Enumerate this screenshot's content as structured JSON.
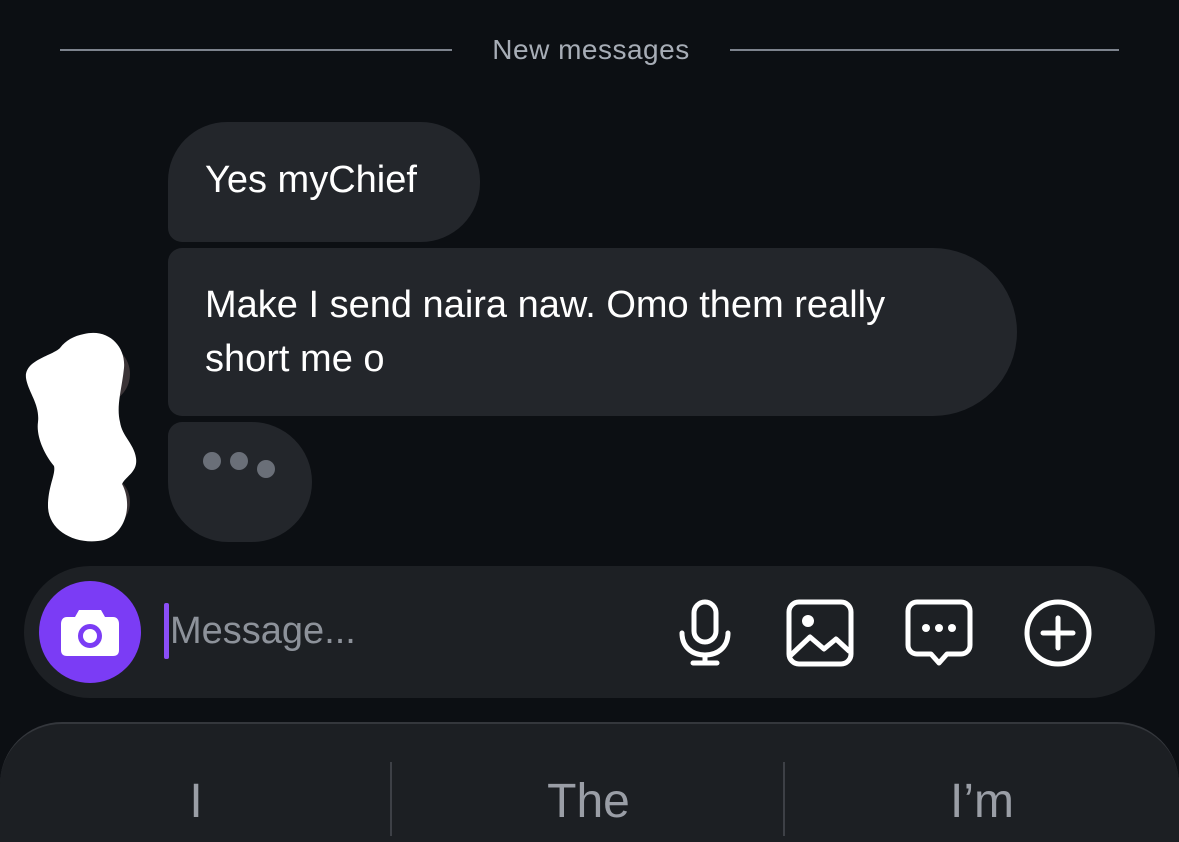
{
  "divider": {
    "label": "New messages"
  },
  "messages": [
    {
      "lines": [
        "Yes myChief"
      ]
    },
    {
      "lines": [
        "Make I send naira naw. Omo them really",
        "short me o"
      ]
    }
  ],
  "typing_indicator": {
    "icon": "typing-dots-icon"
  },
  "composer": {
    "placeholder": "Message...",
    "value": "",
    "camera_icon": "camera-icon",
    "actions": [
      "microphone-icon",
      "image-icon",
      "sticker-icon",
      "plus-circle-icon"
    ]
  },
  "keyboard": {
    "suggestions": [
      "I",
      "The",
      "I’m"
    ]
  },
  "colors": {
    "background": "#0c0f13",
    "bubble": "#23262b",
    "accent": "#7b3cf5",
    "composer": "#1d2024"
  }
}
